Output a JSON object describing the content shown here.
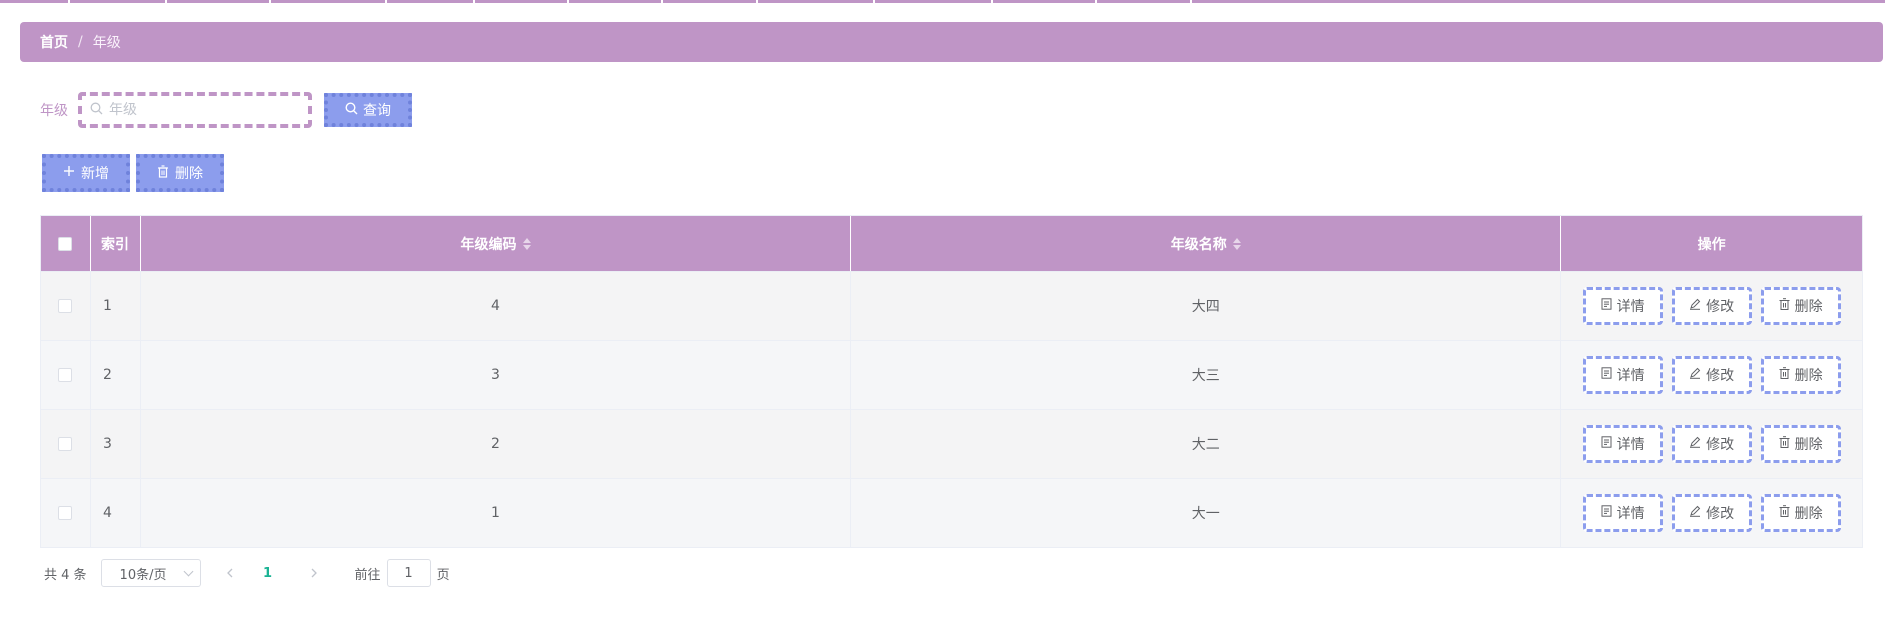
{
  "breadcrumb": {
    "home": "首页",
    "separator": "/",
    "current": "年级"
  },
  "search": {
    "label": "年级",
    "placeholder": "年级",
    "value": "",
    "button_label": "查询",
    "icon": "search-icon"
  },
  "actions": {
    "add_label": "新增",
    "add_icon": "plus-icon",
    "delete_label": "删除",
    "delete_icon": "trash-icon"
  },
  "table": {
    "columns": {
      "index": "索引",
      "code": "年级编码",
      "name": "年级名称",
      "ops": "操作"
    },
    "rows": [
      {
        "index": "1",
        "code": "4",
        "name": "大四"
      },
      {
        "index": "2",
        "code": "3",
        "name": "大三"
      },
      {
        "index": "3",
        "code": "2",
        "name": "大二"
      },
      {
        "index": "4",
        "code": "1",
        "name": "大一"
      }
    ],
    "row_actions": {
      "detail": "详情",
      "edit": "修改",
      "delete": "删除"
    }
  },
  "pagination": {
    "total": "共 4 条",
    "page_size": "10条/页",
    "current_page": "1",
    "goto_label": "前往",
    "goto_value": "1",
    "page_suffix": "页"
  },
  "colors": {
    "accent": "#bf95c6",
    "button": "#8c9ded",
    "current_page": "#1ab394"
  }
}
